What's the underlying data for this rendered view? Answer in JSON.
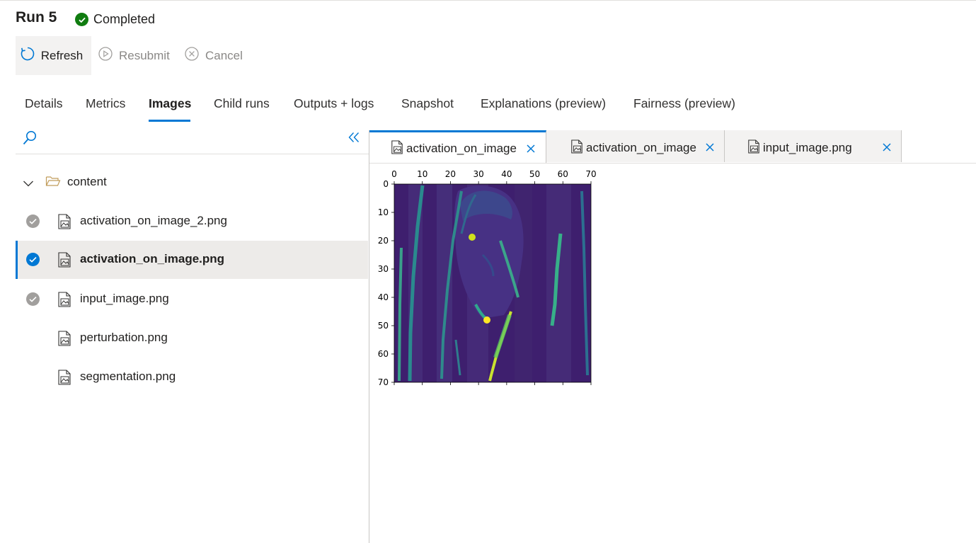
{
  "header": {
    "title": "Run 5",
    "status": "Completed",
    "status_color": "#107c10"
  },
  "toolbar": {
    "refresh": "Refresh",
    "resubmit": "Resubmit",
    "cancel": "Cancel"
  },
  "tabs": [
    {
      "label": "Details",
      "active": false
    },
    {
      "label": "Metrics",
      "active": false
    },
    {
      "label": "Images",
      "active": true
    },
    {
      "label": "Child runs",
      "active": false
    },
    {
      "label": "Outputs + logs",
      "active": false
    },
    {
      "label": "Snapshot",
      "active": false
    },
    {
      "label": "Explanations (preview)",
      "active": false
    },
    {
      "label": "Fairness (preview)",
      "active": false
    }
  ],
  "file_tree": {
    "folder": "content",
    "files": [
      {
        "name": "activation_on_image_2.png",
        "checked": true,
        "selected": false
      },
      {
        "name": "activation_on_image.png",
        "checked": true,
        "selected": true
      },
      {
        "name": "input_image.png",
        "checked": true,
        "selected": false
      },
      {
        "name": "perturbation.png",
        "checked": false,
        "selected": false
      },
      {
        "name": "segmentation.png",
        "checked": false,
        "selected": false
      }
    ]
  },
  "doc_tabs": [
    {
      "label": "activation_on_image",
      "active": true
    },
    {
      "label": "activation_on_image",
      "active": false
    },
    {
      "label": "input_image.png",
      "active": false
    }
  ],
  "plot": {
    "x_ticks": [
      "0",
      "10",
      "20",
      "30",
      "40",
      "50",
      "60",
      "70"
    ],
    "y_ticks": [
      "0",
      "10",
      "20",
      "30",
      "40",
      "50",
      "60",
      "70"
    ],
    "xlim": [
      0,
      70
    ],
    "ylim": [
      0,
      70
    ],
    "colormap": "viridis"
  },
  "colors": {
    "accent": "#0078d4",
    "success": "#107c10",
    "check_gray": "#8a8886",
    "folder": "#c19c5a"
  }
}
